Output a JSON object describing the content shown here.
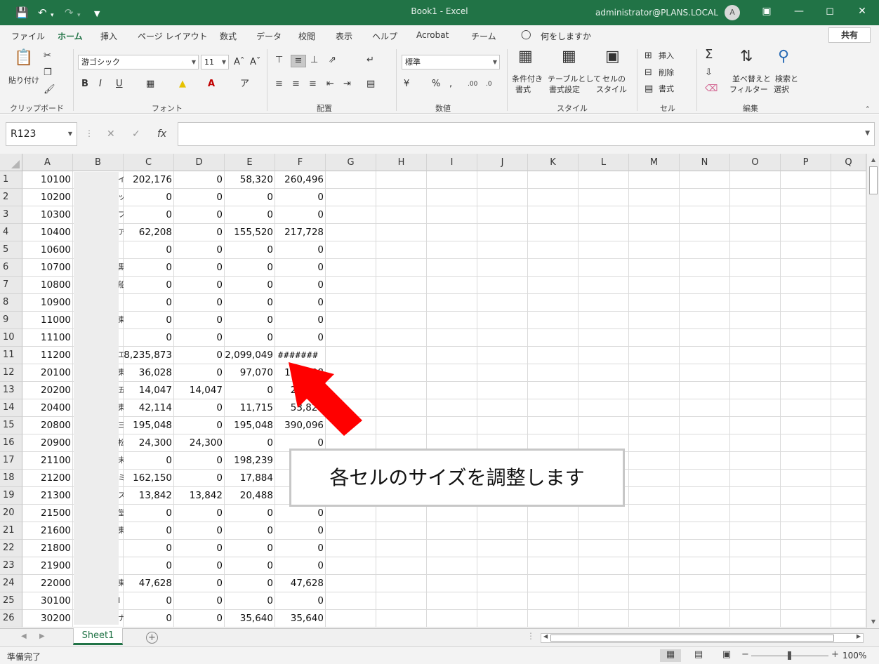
{
  "window": {
    "title": "Book1  -  Excel",
    "user": "administrator@PLANS.LOCAL",
    "avatar": "A"
  },
  "ribbon_tabs": [
    "ファイル",
    "ホーム",
    "挿入",
    "ページ レイアウト",
    "数式",
    "データ",
    "校閲",
    "表示",
    "ヘルプ",
    "Acrobat",
    "チーム"
  ],
  "tell_me": "何をしますか",
  "share_label": "共有",
  "ribbon": {
    "paste": "貼り付け",
    "clipboard": "クリップボード",
    "font_name": "游ゴシック",
    "font_size": "11",
    "font": "フォント",
    "alignment": "配置",
    "number_format": "標準",
    "number": "数値",
    "conditional_1": "条件付き",
    "conditional_2": "書式",
    "table_1": "テーブルとして",
    "table_2": "書式設定",
    "cellstyle_1": "セルの",
    "cellstyle_2": "スタイル",
    "styles": "スタイル",
    "insert": "挿入",
    "delete": "削除",
    "format": "書式",
    "cells": "セル",
    "sort_1": "並べ替えと",
    "sort_2": "フィルター",
    "find_1": "検索と",
    "find_2": "選択",
    "editing": "編集"
  },
  "formula_bar": {
    "name_box": "R123",
    "formula": ""
  },
  "columns": [
    "A",
    "B",
    "C",
    "D",
    "E",
    "F",
    "G",
    "H",
    "I",
    "J",
    "K",
    "L",
    "M",
    "N",
    "O",
    "P",
    "Q"
  ],
  "rows": [
    {
      "n": "1",
      "a": "10100",
      "b": "イ",
      "c": "202,176",
      "d": "0",
      "e": "58,320",
      "f": "260,496"
    },
    {
      "n": "2",
      "a": "10200",
      "b": "ッ",
      "c": "0",
      "d": "0",
      "e": "0",
      "f": "0"
    },
    {
      "n": "3",
      "a": "10300",
      "b": "フ",
      "c": "0",
      "d": "0",
      "e": "0",
      "f": "0"
    },
    {
      "n": "4",
      "a": "10400",
      "b": "ア",
      "c": "62,208",
      "d": "0",
      "e": "155,520",
      "f": "217,728"
    },
    {
      "n": "5",
      "a": "10600",
      "b": "",
      "c": "0",
      "d": "0",
      "e": "0",
      "f": "0"
    },
    {
      "n": "6",
      "a": "10700",
      "b": "黒",
      "c": "0",
      "d": "0",
      "e": "0",
      "f": "0"
    },
    {
      "n": "7",
      "a": "10800",
      "b": "船",
      "c": "0",
      "d": "0",
      "e": "0",
      "f": "0"
    },
    {
      "n": "8",
      "a": "10900",
      "b": "",
      "c": "0",
      "d": "0",
      "e": "0",
      "f": "0"
    },
    {
      "n": "9",
      "a": "11000",
      "b": "東",
      "c": "0",
      "d": "0",
      "e": "0",
      "f": "0"
    },
    {
      "n": "10",
      "a": "11100",
      "b": "",
      "c": "0",
      "d": "0",
      "e": "0",
      "f": "0"
    },
    {
      "n": "11",
      "a": "11200",
      "b": "エ",
      "c": "8,235,873",
      "d": "0",
      "e": "2,099,049",
      "f": "#######"
    },
    {
      "n": "12",
      "a": "20100",
      "b": "東",
      "c": "36,028",
      "d": "0",
      "e": "97,070",
      "f": "133,098"
    },
    {
      "n": "13",
      "a": "20200",
      "b": "五",
      "c": "14,047",
      "d": "14,047",
      "e": "0",
      "f": "28,094"
    },
    {
      "n": "14",
      "a": "20400",
      "b": "東",
      "c": "42,114",
      "d": "0",
      "e": "11,715",
      "f": "53,829"
    },
    {
      "n": "15",
      "a": "20800",
      "b": "三",
      "c": "195,048",
      "d": "0",
      "e": "195,048",
      "f": "390,096"
    },
    {
      "n": "16",
      "a": "20900",
      "b": "松",
      "c": "24,300",
      "d": "24,300",
      "e": "0",
      "f": "0"
    },
    {
      "n": "17",
      "a": "21100",
      "b": "末",
      "c": "0",
      "d": "0",
      "e": "198,239",
      "f": ""
    },
    {
      "n": "18",
      "a": "21200",
      "b": "ミ",
      "c": "162,150",
      "d": "0",
      "e": "17,884",
      "f": ""
    },
    {
      "n": "19",
      "a": "21300",
      "b": "ス",
      "c": "13,842",
      "d": "13,842",
      "e": "20,488",
      "f": ""
    },
    {
      "n": "20",
      "a": "21500",
      "b": "堂",
      "c": "0",
      "d": "0",
      "e": "0",
      "f": "0"
    },
    {
      "n": "21",
      "a": "21600",
      "b": "東",
      "c": "0",
      "d": "0",
      "e": "0",
      "f": "0"
    },
    {
      "n": "22",
      "a": "21800",
      "b": "",
      "c": "0",
      "d": "0",
      "e": "0",
      "f": "0"
    },
    {
      "n": "23",
      "a": "21900",
      "b": "",
      "c": "0",
      "d": "0",
      "e": "0",
      "f": "0"
    },
    {
      "n": "24",
      "a": "22000",
      "b": "東",
      "c": "47,628",
      "d": "0",
      "e": "0",
      "f": "47,628"
    },
    {
      "n": "25",
      "a": "30100",
      "b": "I",
      "c": "0",
      "d": "0",
      "e": "0",
      "f": "0"
    },
    {
      "n": "26",
      "a": "30200",
      "b": "ナ",
      "c": "0",
      "d": "0",
      "e": "35,640",
      "f": "35,640"
    }
  ],
  "callout_text": "各セルのサイズを調整します",
  "arrow_color": "#ff0000",
  "accent_color": "#217346",
  "sheet_tab": "Sheet1",
  "status": {
    "ready": "準備完了",
    "zoom": "100%"
  }
}
